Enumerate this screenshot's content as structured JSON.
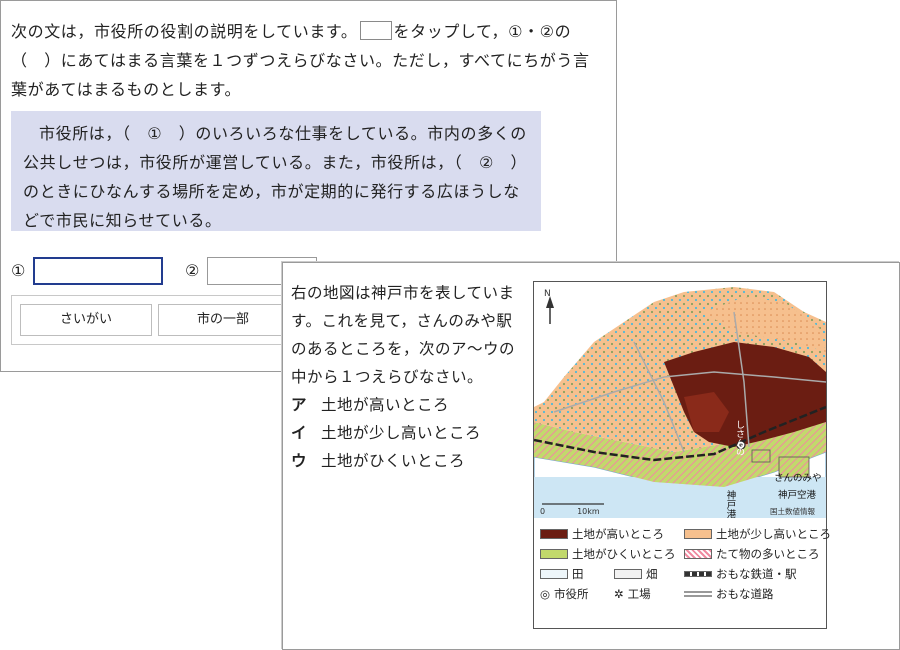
{
  "question1": {
    "text_before_box": "次の文は，市役所の役割の説明をしています。",
    "text_after_box": "をタップして，①・②の（　）にあてはまる言葉を１つずつえらびなさい。ただし，すべてにちがう言葉があてはまるものとします。",
    "passage": "市役所は，（　①　）のいろいろな仕事をしている。市内の多くの公共しせつは，市役所が運営している。また，市役所は，（　②　）のときにひなんする場所を定め，市が定期的に発行する広ほうしなどで市民に知らせている。",
    "answer1_label": "①",
    "answer2_label": "②",
    "choices": [
      "さいがい",
      "市の一部"
    ]
  },
  "question2": {
    "text": "右の地図は神戸市を表しています。これを見て，さんのみや駅のあるところを，次のア～ウの中から１つえらびなさい。",
    "options": [
      {
        "mark": "ア",
        "text": "土地が高いところ"
      },
      {
        "mark": "イ",
        "text": "土地が少し高いところ"
      },
      {
        "mark": "ウ",
        "text": "土地がひくいところ"
      }
    ]
  },
  "map": {
    "place_labels": [
      "しさんの",
      "神戸港",
      "さんのみや",
      "神戸空港"
    ],
    "scale_label": "0　　　　10km",
    "credit": "国土数値情報",
    "north_label": "N",
    "legend": [
      {
        "label": "土地が高いところ",
        "color": "#6b1d12"
      },
      {
        "label": "土地が少し高いところ",
        "color": "#f6c08e"
      },
      {
        "label": "土地がひくいところ",
        "color": "#c2d96c"
      },
      {
        "label": "たて物の多いところ",
        "color": "#f08aa0"
      },
      {
        "label": "田",
        "color": "#4fb8d8"
      },
      {
        "label": "畑",
        "color": "#8a8a8a"
      },
      {
        "label": "おもな鉄道・駅",
        "color": "#333333"
      },
      {
        "label": "市役所",
        "color": "#333333"
      },
      {
        "label": "工場",
        "color": "#333333"
      },
      {
        "label": "おもな道路",
        "color": "#999999"
      }
    ]
  }
}
